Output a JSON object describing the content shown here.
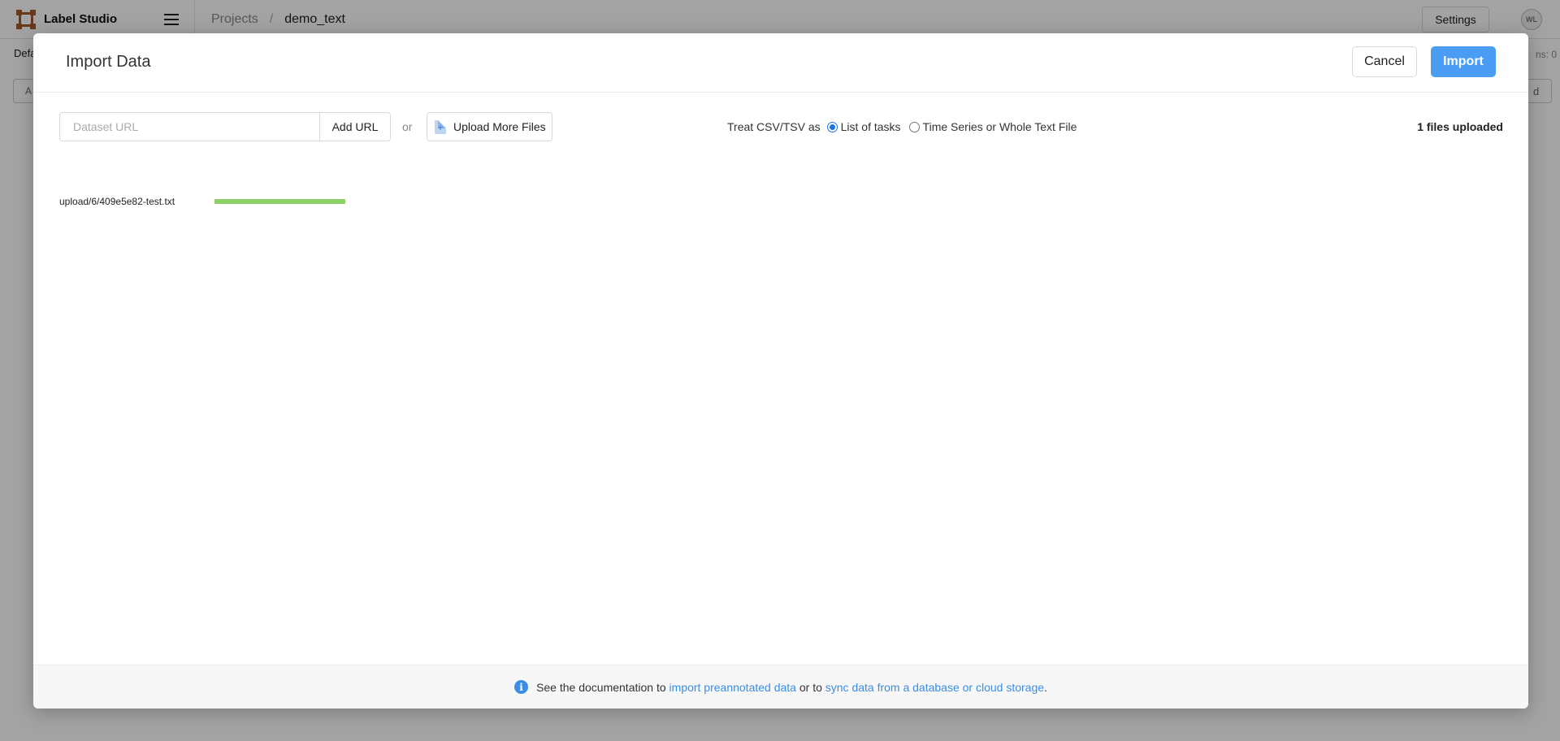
{
  "app": {
    "brand_name": "Label Studio",
    "breadcrumb": {
      "projects": "Projects",
      "separator": "/",
      "current": "demo_text"
    },
    "settings_label": "Settings",
    "avatar_initials": "WL",
    "subbar_left": "Defa",
    "subbar_right": "ns: 0",
    "bg_button_left": "A",
    "bg_button_right": "d"
  },
  "modal": {
    "title": "Import Data",
    "cancel_label": "Cancel",
    "import_label": "Import",
    "url_input": {
      "placeholder": "Dataset URL",
      "value": ""
    },
    "add_url_label": "Add URL",
    "or_text": "or",
    "upload_more_label": "Upload More Files",
    "csv_prompt": "Treat CSV/TSV as",
    "csv_options": [
      {
        "label": "List of tasks",
        "selected": true
      },
      {
        "label": "Time Series or Whole Text File",
        "selected": false
      }
    ],
    "files_uploaded": "1 files uploaded",
    "files": [
      {
        "name": "upload/6/409e5e82-test.txt",
        "progress_percent": 100
      }
    ],
    "footer": {
      "prefix": "See the documentation to ",
      "link1": "import preannotated data",
      "middle": " or to ",
      "link2": "sync data from a database or cloud storage",
      "suffix": "."
    }
  },
  "colors": {
    "primary": "#4a9cf5",
    "link": "#3a8ee6",
    "progress": "#8fd06a",
    "brand": "#a3592a"
  }
}
